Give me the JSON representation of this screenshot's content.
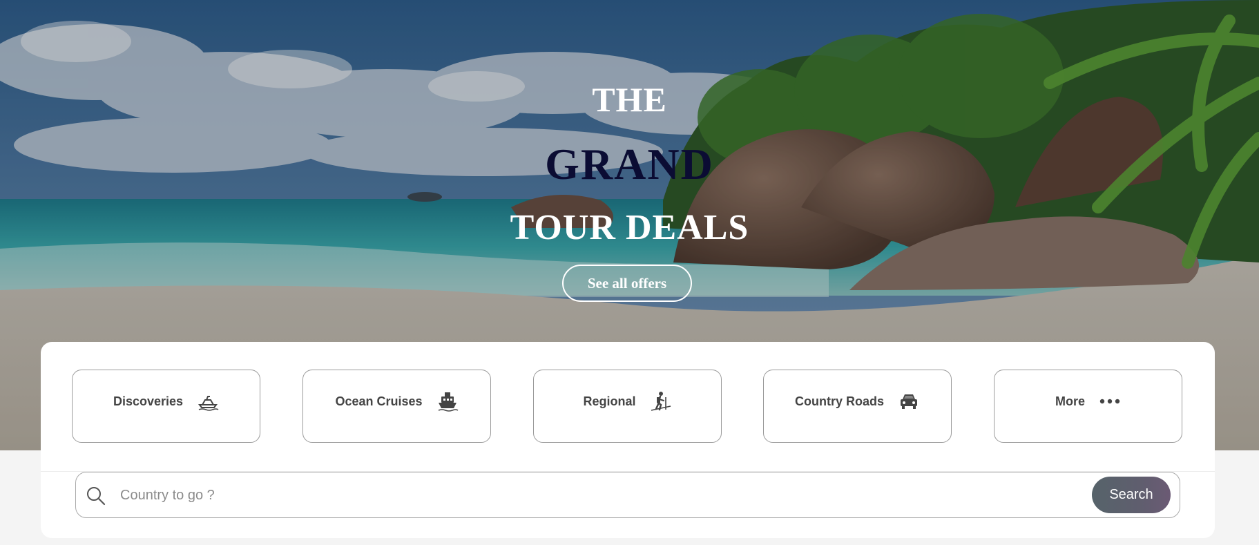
{
  "hero": {
    "title_line1": "THE",
    "title_line2": "GRAND",
    "title_line3": "TOUR DEALS",
    "cta_label": "See all offers"
  },
  "categories": [
    {
      "label": "Discoveries",
      "icon": "jet-ski-icon"
    },
    {
      "label": "Ocean Cruises",
      "icon": "ship-icon"
    },
    {
      "label": "Regional",
      "icon": "hiker-icon"
    },
    {
      "label": "Country Roads",
      "icon": "car-icon"
    },
    {
      "label": "More",
      "icon": "more-dots-icon"
    }
  ],
  "search": {
    "placeholder": "Country to go ?",
    "value": "",
    "button_label": "Search"
  },
  "colors": {
    "grand_text": "#0b0c33",
    "search_button": "#5f5e6e",
    "panel_bg": "#ffffff"
  }
}
